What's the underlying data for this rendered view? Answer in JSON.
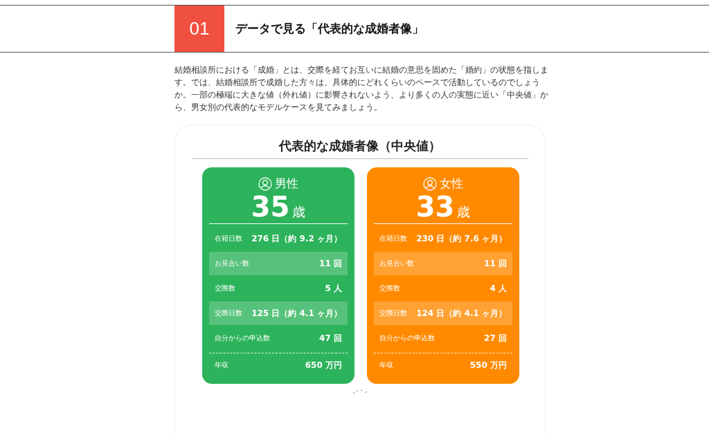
{
  "section": {
    "number": "01",
    "title": "データで見る「代表的な成婚者像」"
  },
  "intro": "結婚相談所における「成婚」とは、交際を経てお互いに結婚の意思を固めた「婚約」の状態を指します。では、結婚相談所で成婚した方々は、具体的にどれくらいのペースで活動しているのでしょうか。一部の極端に大きな値（外れ値）に影響されないよう、より多くの人の実態に近い「中央値」から、男女別の代表的なモデルケースを見てみましょう。",
  "card": {
    "title": "代表的な成婚者像（中央値）",
    "panels": [
      {
        "gender": "男性",
        "color": "#2db35b",
        "age": "35",
        "age_unit": "歳",
        "rows": [
          {
            "label": "在籍日数",
            "value": "276 日（約 9.2 ヶ月）",
            "shaded": false,
            "kind": "stat"
          },
          {
            "label": "お見合い数",
            "value": "11 回",
            "shaded": true,
            "kind": "stat"
          },
          {
            "label": "交際数",
            "value": "5 人",
            "shaded": false,
            "kind": "stat"
          },
          {
            "label": "交際日数",
            "value": "125 日（約 4.1 ヶ月）",
            "shaded": true,
            "kind": "stat"
          },
          {
            "label": "自分からの申込数",
            "value": "47 回",
            "shaded": false,
            "kind": "stat"
          },
          {
            "label": "年収",
            "value": "650 万円",
            "shaded": false,
            "kind": "total"
          }
        ]
      },
      {
        "gender": "女性",
        "color": "#ff8a00",
        "age": "33",
        "age_unit": "歳",
        "rows": [
          {
            "label": "在籍日数",
            "value": "230 日（約 7.6 ヶ月）",
            "shaded": false,
            "kind": "stat"
          },
          {
            "label": "お見合い数",
            "value": "11 回",
            "shaded": true,
            "kind": "stat"
          },
          {
            "label": "交際数",
            "value": "4 人",
            "shaded": false,
            "kind": "stat"
          },
          {
            "label": "交際日数",
            "value": "124 日（約 4.1 ヶ月）",
            "shaded": true,
            "kind": "stat"
          },
          {
            "label": "自分からの申込数",
            "value": "27 回",
            "shaded": false,
            "kind": "stat"
          },
          {
            "label": "年収",
            "value": "550 万円",
            "shaded": false,
            "kind": "total"
          }
        ]
      }
    ]
  }
}
